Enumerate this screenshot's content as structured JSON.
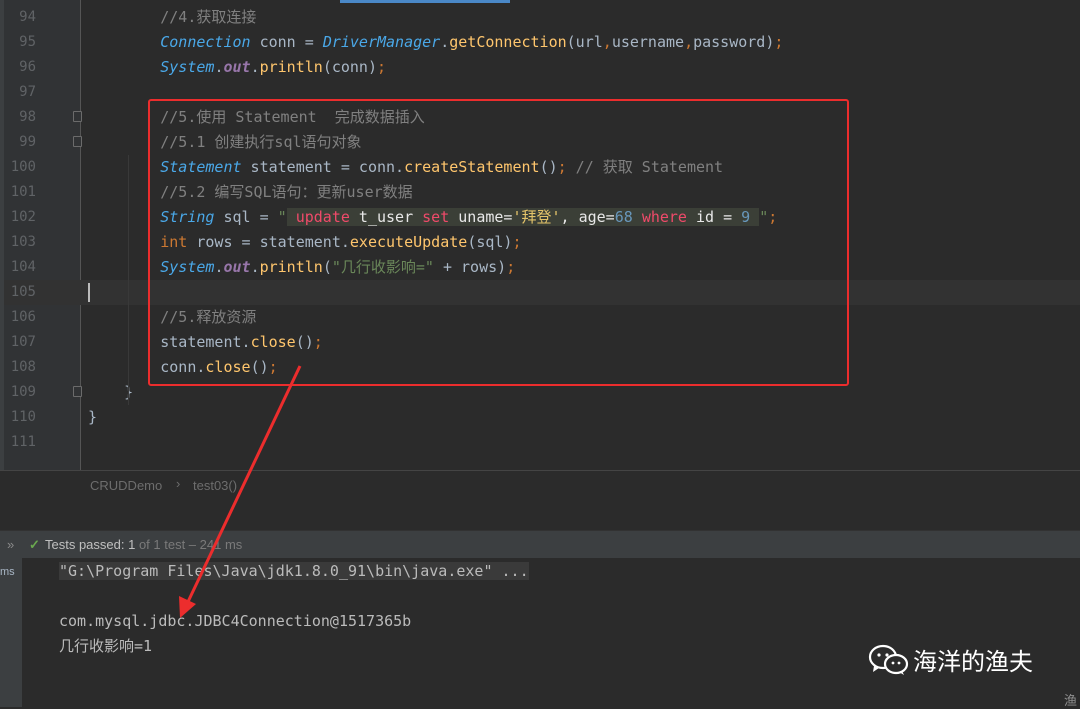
{
  "editor": {
    "lines": [
      {
        "num": "94",
        "tokens": [
          {
            "t": "        "
          },
          {
            "t": "//4.获取连接",
            "c": "cm"
          }
        ]
      },
      {
        "num": "95",
        "tokens": [
          {
            "t": "        "
          },
          {
            "t": "Connection",
            "c": "ty"
          },
          {
            "t": " conn = "
          },
          {
            "t": "DriverManager",
            "c": "ty"
          },
          {
            "t": "."
          },
          {
            "t": "getConnection",
            "c": "fn"
          },
          {
            "t": "(url"
          },
          {
            "t": ",",
            "c": "kw"
          },
          {
            "t": "username"
          },
          {
            "t": ",",
            "c": "kw"
          },
          {
            "t": "password)"
          },
          {
            "t": ";",
            "c": "kw"
          }
        ]
      },
      {
        "num": "96",
        "tokens": [
          {
            "t": "        "
          },
          {
            "t": "System",
            "c": "ty"
          },
          {
            "t": "."
          },
          {
            "t": "out",
            "c": "sft"
          },
          {
            "t": "."
          },
          {
            "t": "println",
            "c": "fn"
          },
          {
            "t": "(conn)"
          },
          {
            "t": ";",
            "c": "kw"
          }
        ]
      },
      {
        "num": "97",
        "tokens": []
      },
      {
        "num": "98",
        "tokens": [
          {
            "t": "        "
          },
          {
            "t": "//5.使用 Statement  完成数据插入",
            "c": "cm"
          }
        ]
      },
      {
        "num": "99",
        "tokens": [
          {
            "t": "        "
          },
          {
            "t": "//5.1 创建执行sql语句对象",
            "c": "cm"
          }
        ]
      },
      {
        "num": "100",
        "tokens": [
          {
            "t": "        "
          },
          {
            "t": "Statement",
            "c": "ty"
          },
          {
            "t": " statement = conn."
          },
          {
            "t": "createStatement",
            "c": "fn"
          },
          {
            "t": "()"
          },
          {
            "t": ";",
            "c": "kw"
          },
          {
            "t": " // 获取 Statement",
            "c": "cm"
          }
        ]
      },
      {
        "num": "101",
        "tokens": [
          {
            "t": "        "
          },
          {
            "t": "//5.2 编写SQL语句：更新user数据",
            "c": "cm"
          }
        ]
      },
      {
        "num": "102",
        "tokens": [
          {
            "t": "        "
          },
          {
            "t": "String",
            "c": "ty"
          },
          {
            "t": " sql = "
          },
          {
            "t": "\"",
            "c": "st"
          },
          {
            "t": " ",
            "c": "sqlbg"
          },
          {
            "t": "update",
            "c": "sqlbg sqlkw"
          },
          {
            "t": " t_user ",
            "c": "sqlbg sqlval"
          },
          {
            "t": "set",
            "c": "sqlbg sqlkw"
          },
          {
            "t": " uname=",
            "c": "sqlbg sqlval"
          },
          {
            "t": "'拜登'",
            "c": "sqlbg sqlstr"
          },
          {
            "t": ", age=",
            "c": "sqlbg sqlval"
          },
          {
            "t": "68",
            "c": "sqlbg nm"
          },
          {
            "t": " ",
            "c": "sqlbg"
          },
          {
            "t": "where",
            "c": "sqlbg sqlkw"
          },
          {
            "t": " id = ",
            "c": "sqlbg sqlval"
          },
          {
            "t": "9",
            "c": "sqlbg nm"
          },
          {
            "t": " ",
            "c": "sqlbg"
          },
          {
            "t": "\"",
            "c": "st"
          },
          {
            "t": ";",
            "c": "kw"
          }
        ]
      },
      {
        "num": "103",
        "tokens": [
          {
            "t": "        "
          },
          {
            "t": "int",
            "c": "kw"
          },
          {
            "t": " rows = statement."
          },
          {
            "t": "executeUpdate",
            "c": "fn"
          },
          {
            "t": "(sql)"
          },
          {
            "t": ";",
            "c": "kw"
          }
        ]
      },
      {
        "num": "104",
        "tokens": [
          {
            "t": "        "
          },
          {
            "t": "System",
            "c": "ty"
          },
          {
            "t": "."
          },
          {
            "t": "out",
            "c": "sft"
          },
          {
            "t": "."
          },
          {
            "t": "println",
            "c": "fn"
          },
          {
            "t": "("
          },
          {
            "t": "\"几行收影响=\"",
            "c": "st"
          },
          {
            "t": " + rows)"
          },
          {
            "t": ";",
            "c": "kw"
          }
        ]
      },
      {
        "num": "105",
        "tokens": [],
        "current": true
      },
      {
        "num": "106",
        "tokens": [
          {
            "t": "        "
          },
          {
            "t": "//5.释放资源",
            "c": "cm"
          }
        ]
      },
      {
        "num": "107",
        "tokens": [
          {
            "t": "        "
          },
          {
            "t": "statement."
          },
          {
            "t": "close",
            "c": "fn"
          },
          {
            "t": "()"
          },
          {
            "t": ";",
            "c": "kw"
          }
        ]
      },
      {
        "num": "108",
        "tokens": [
          {
            "t": "        "
          },
          {
            "t": "conn."
          },
          {
            "t": "close",
            "c": "fn"
          },
          {
            "t": "()"
          },
          {
            "t": ";",
            "c": "kw"
          }
        ]
      },
      {
        "num": "109",
        "tokens": [
          {
            "t": "    }"
          }
        ]
      },
      {
        "num": "110",
        "tokens": [
          {
            "t": "}"
          }
        ]
      },
      {
        "num": "111",
        "tokens": []
      }
    ]
  },
  "breadcrumb": {
    "items": [
      "CRUDDemo",
      "test03()"
    ],
    "separator": "›"
  },
  "test_panel": {
    "chevron": "»",
    "check": "✓",
    "status_strong": "Tests passed: 1",
    "status_dim": " of 1 test – 241 ms"
  },
  "console": {
    "side_label": "ms",
    "lines": [
      "\"G:\\Program Files\\Java\\jdk1.8.0_91\\bin\\java.exe\" ...",
      "",
      "com.mysql.jdbc.JDBC4Connection@1517365b",
      "几行收影响=1"
    ]
  },
  "watermark": {
    "text": "海洋的渔夫",
    "icon": "wechat-icon"
  },
  "colors": {
    "annotation_red": "#ec2d2d",
    "pass_green": "#6aa84f",
    "editor_bg": "#2b2b2b"
  }
}
